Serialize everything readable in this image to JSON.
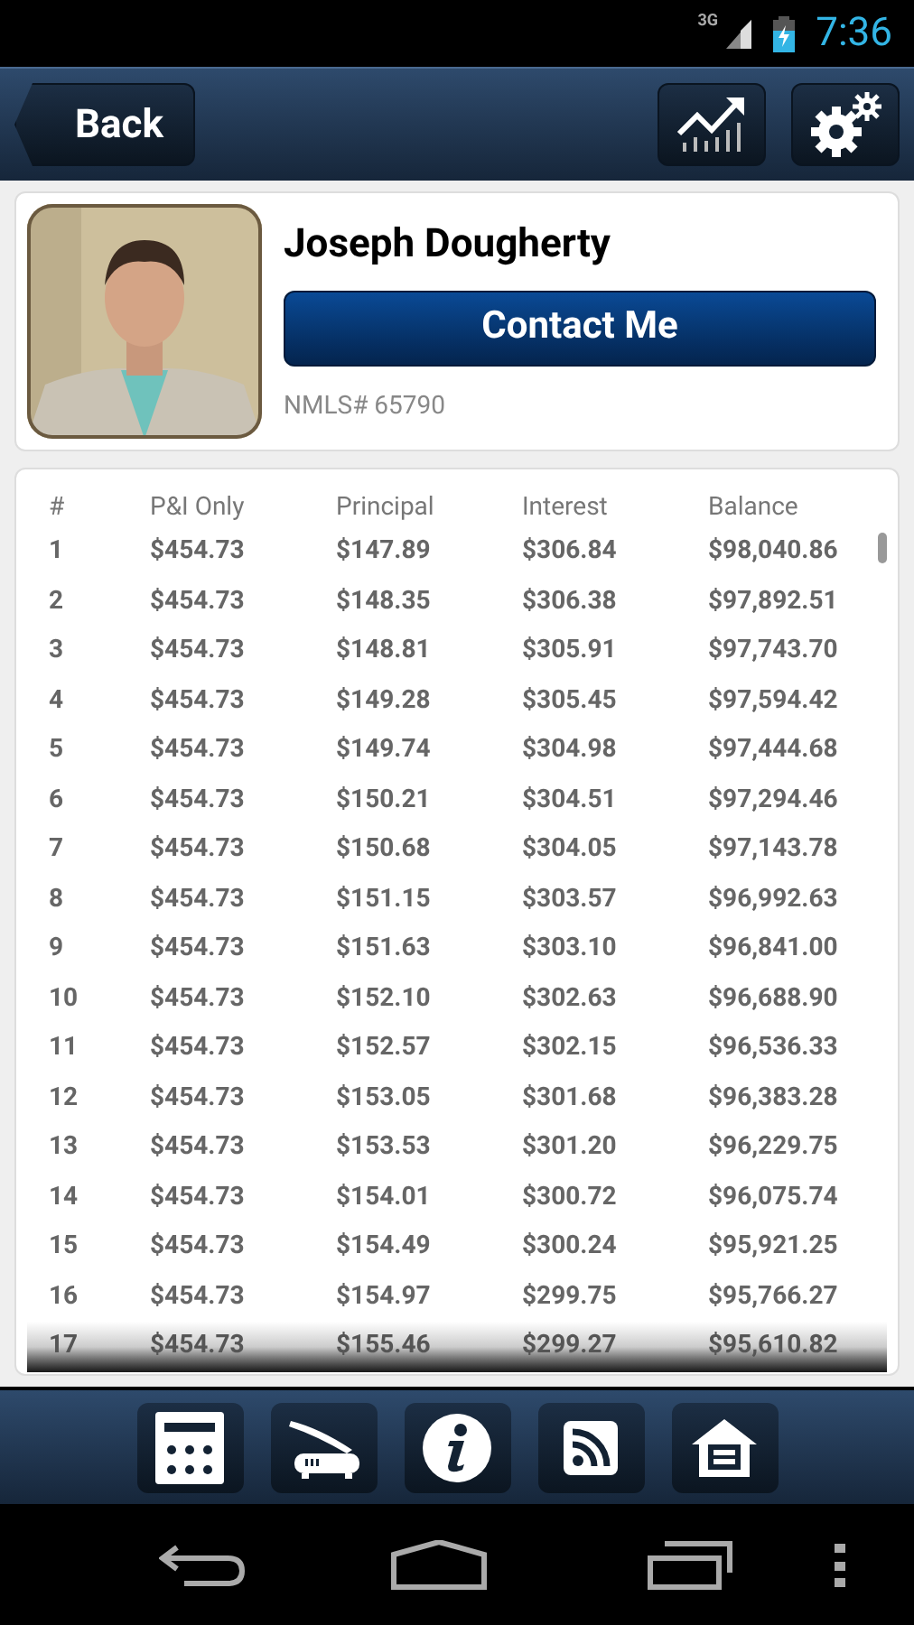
{
  "status_bar": {
    "network": "3G",
    "time": "7:36"
  },
  "header": {
    "back_label": "Back"
  },
  "profile": {
    "name": "Joseph Dougherty",
    "contact_label": "Contact Me",
    "nmls": "NMLS# 65790"
  },
  "table": {
    "columns": [
      "#",
      "P&I Only",
      "Principal",
      "Interest",
      "Balance"
    ],
    "rows": [
      [
        "1",
        "$454.73",
        "$147.89",
        "$306.84",
        "$98,040.86"
      ],
      [
        "2",
        "$454.73",
        "$148.35",
        "$306.38",
        "$97,892.51"
      ],
      [
        "3",
        "$454.73",
        "$148.81",
        "$305.91",
        "$97,743.70"
      ],
      [
        "4",
        "$454.73",
        "$149.28",
        "$305.45",
        "$97,594.42"
      ],
      [
        "5",
        "$454.73",
        "$149.74",
        "$304.98",
        "$97,444.68"
      ],
      [
        "6",
        "$454.73",
        "$150.21",
        "$304.51",
        "$97,294.46"
      ],
      [
        "7",
        "$454.73",
        "$150.68",
        "$304.05",
        "$97,143.78"
      ],
      [
        "8",
        "$454.73",
        "$151.15",
        "$303.57",
        "$96,992.63"
      ],
      [
        "9",
        "$454.73",
        "$151.63",
        "$303.10",
        "$96,841.00"
      ],
      [
        "10",
        "$454.73",
        "$152.10",
        "$302.63",
        "$96,688.90"
      ],
      [
        "11",
        "$454.73",
        "$152.57",
        "$302.15",
        "$96,536.33"
      ],
      [
        "12",
        "$454.73",
        "$153.05",
        "$301.68",
        "$96,383.28"
      ],
      [
        "13",
        "$454.73",
        "$153.53",
        "$301.20",
        "$96,229.75"
      ],
      [
        "14",
        "$454.73",
        "$154.01",
        "$300.72",
        "$96,075.74"
      ],
      [
        "15",
        "$454.73",
        "$154.49",
        "$300.24",
        "$95,921.25"
      ],
      [
        "16",
        "$454.73",
        "$154.97",
        "$299.75",
        "$95,766.27"
      ],
      [
        "17",
        "$454.73",
        "$155.46",
        "$299.27",
        "$95,610.82"
      ]
    ]
  }
}
